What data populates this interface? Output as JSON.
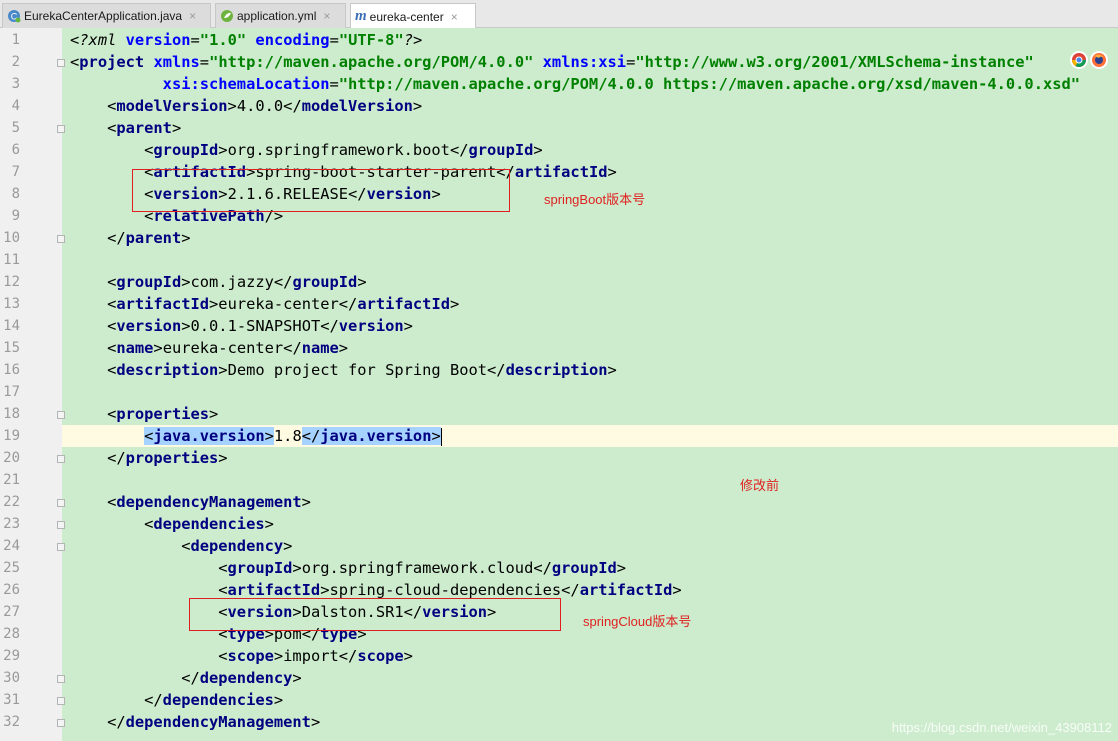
{
  "tabs": [
    {
      "label": "EurekaCenterApplication.java",
      "icon": "java-class-icon",
      "active": false
    },
    {
      "label": "application.yml",
      "icon": "spring-yml-icon",
      "active": false
    },
    {
      "label": "eureka-center",
      "icon": "maven-m-icon",
      "active": true
    }
  ],
  "tab_close_glyph": "×",
  "maven_icon_glyph": "m",
  "annotations": {
    "springboot_version": "springBoot版本号",
    "before_modification": "修改前",
    "springcloud_version": "springCloud版本号"
  },
  "browser_icons": [
    "chrome-icon",
    "firefox-icon"
  ],
  "watermark": "https://blog.csdn.net/weixin_43908112",
  "colors": {
    "editor_bg": "#cdeccd",
    "tag": "#000080",
    "attr_value": "#008000",
    "highlight_box": "#e02020"
  },
  "line_numbers": [
    "1",
    "2",
    "3",
    "4",
    "5",
    "6",
    "7",
    "8",
    "9",
    "10",
    "11",
    "12",
    "13",
    "14",
    "15",
    "16",
    "17",
    "18",
    "19",
    "20",
    "21",
    "22",
    "23",
    "24",
    "25",
    "26",
    "27",
    "28",
    "29",
    "30",
    "31",
    "32"
  ],
  "lines": {
    "l1": {
      "decl": "?xml",
      "a1": "version",
      "v1": "\"1.0\"",
      "a2": "encoding",
      "v2": "\"UTF-8\""
    },
    "l2": {
      "tag": "project",
      "a1": "xmlns",
      "v1": "\"http://maven.apache.org/POM/4.0.0\"",
      "a2": "xmlns:xsi",
      "v2": "\"http://www.w3.org/2001/XMLSchema-instance\""
    },
    "l3": {
      "a1": "xsi:schemaLocation",
      "v1": "\"http://maven.apache.org/POM/4.0.0 https://maven.apache.org/xsd/maven-4.0.0.xsd\""
    },
    "l4": {
      "tag": "modelVersion",
      "value": "4.0.0"
    },
    "l5": {
      "tag": "parent"
    },
    "l6": {
      "tag": "groupId",
      "value": "org.springframework.boot"
    },
    "l7": {
      "tag": "artifactId",
      "value": "spring-boot-starter-parent"
    },
    "l8": {
      "tag": "version",
      "value": "2.1.6.RELEASE"
    },
    "l9": {
      "tag": "relativePath"
    },
    "l10": {
      "tag": "parent"
    },
    "l12": {
      "tag": "groupId",
      "value": "com.jazzy"
    },
    "l13": {
      "tag": "artifactId",
      "value": "eureka-center"
    },
    "l14": {
      "tag": "version",
      "value": "0.0.1-SNAPSHOT"
    },
    "l15": {
      "tag": "name",
      "value": "eureka-center"
    },
    "l16": {
      "tag": "description",
      "value": "Demo project for Spring Boot"
    },
    "l18": {
      "tag": "properties"
    },
    "l19": {
      "tag": "java.version",
      "value": "1.8"
    },
    "l20": {
      "tag": "properties"
    },
    "l22": {
      "tag": "dependencyManagement"
    },
    "l23": {
      "tag": "dependencies"
    },
    "l24": {
      "tag": "dependency"
    },
    "l25": {
      "tag": "groupId",
      "value": "org.springframework.cloud"
    },
    "l26": {
      "tag": "artifactId",
      "value": "spring-cloud-dependencies"
    },
    "l27": {
      "tag": "version",
      "value": "Dalston.SR1"
    },
    "l28": {
      "tag": "type",
      "value": "pom"
    },
    "l29": {
      "tag": "scope",
      "value": "import"
    },
    "l30": {
      "tag": "dependency"
    },
    "l31": {
      "tag": "dependencies"
    },
    "l32": {
      "tag": "dependencyManagement"
    }
  }
}
